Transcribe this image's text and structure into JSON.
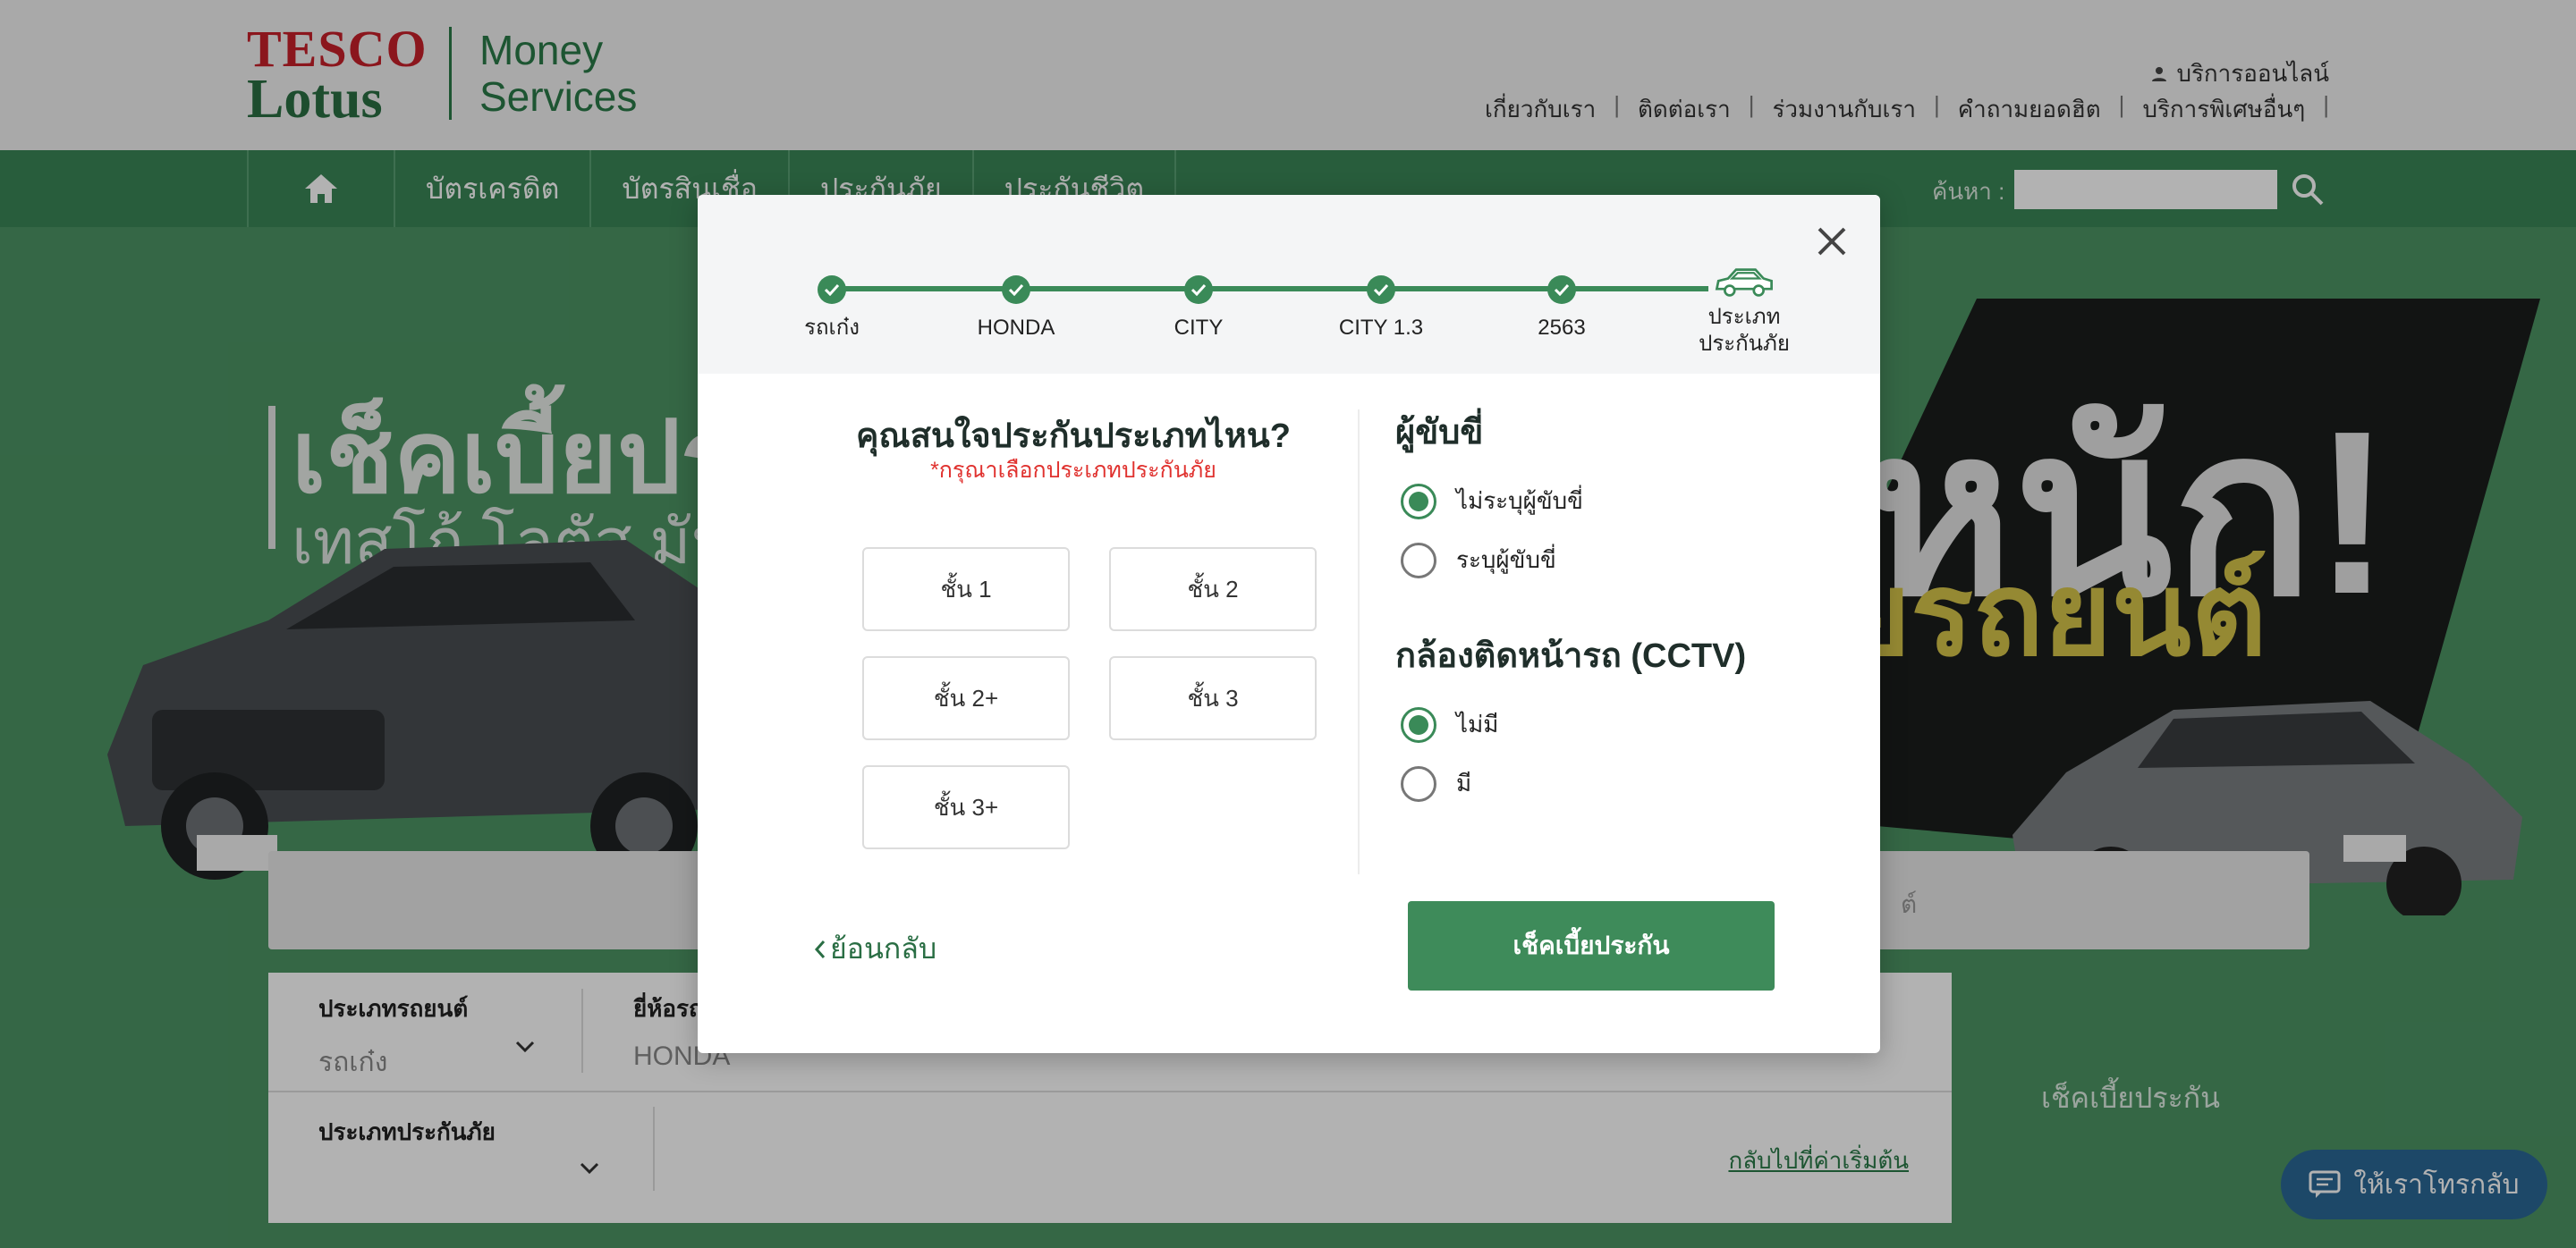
{
  "brand": {
    "tesco": "TESCO",
    "lotus": "Lotus",
    "money_services_line1": "Money",
    "money_services_line2": "Services"
  },
  "header": {
    "online_service": "บริการออนไลน์",
    "links": [
      "เกี่ยวกับเรา",
      "ติดต่อเรา",
      "ร่วมงานกับเรา",
      "คำถามยอดฮิต",
      "บริการพิเศษอื่นๆ"
    ]
  },
  "main_nav": {
    "items": [
      "บัตรเครดิต",
      "บัตรสินเชื่อ",
      "ประกันภัย",
      "ประกันชีวิต"
    ],
    "search_label": "ค้นหา :"
  },
  "hero": {
    "line1": "เช็คเบี้ยประกั",
    "line2": "เทสโก้ โลตัส มันนี่",
    "big_text": "หนัก!",
    "yellow_text": "ยรถยนต์"
  },
  "bg_form": {
    "car_type_label": "ประเภทรถยนต์",
    "car_type_value": "รถเก๋ง",
    "brand_label": "ยี่ห้อรถ",
    "brand_value": "HONDA",
    "insurance_type_label": "ประเภทประกันภัย",
    "reset_link": "กลับไปที่ค่าเริ่มต้น",
    "submit_label": "เช็คเบี้ยประกัน",
    "greybar_hint": "ต์"
  },
  "callback_button": "ให้เราโทรกลับ",
  "modal": {
    "steps": [
      {
        "label": "รถเก๋ง"
      },
      {
        "label": "HONDA"
      },
      {
        "label": "CITY"
      },
      {
        "label": "CITY 1.3"
      },
      {
        "label": "2563"
      },
      {
        "label": "ประเภท ประกันภัย"
      }
    ],
    "question_title": "คุณสนใจประกันประเภทไหน?",
    "question_required": "*กรุณาเลือกประเภทประกันภัย",
    "options": [
      "ชั้น 1",
      "ชั้น 2",
      "ชั้น 2+",
      "ชั้น 3",
      "ชั้น 3+"
    ],
    "driver_title": "ผู้ขับขี่",
    "driver_options": [
      {
        "label": "ไม่ระบุผู้ขับขี่",
        "selected": true
      },
      {
        "label": "ระบุผู้ขับขี่",
        "selected": false
      }
    ],
    "cctv_title": "กล้องติดหน้ารถ (CCTV)",
    "cctv_options": [
      {
        "label": "ไม่มี",
        "selected": true
      },
      {
        "label": "มี",
        "selected": false
      }
    ],
    "back_label": "ย้อนกลับ",
    "check_label": "เช็คเบี้ยประกัน"
  },
  "colors": {
    "brand_green": "#3a8a58",
    "required_red": "#e0322f",
    "callback_blue": "#2a6896"
  },
  "icons": {
    "close": "close-icon",
    "home": "home-icon",
    "search": "search-icon",
    "user": "user-icon",
    "check": "check-icon",
    "car": "car-icon",
    "back": "chevron-left-icon",
    "chat": "chat-icon"
  }
}
